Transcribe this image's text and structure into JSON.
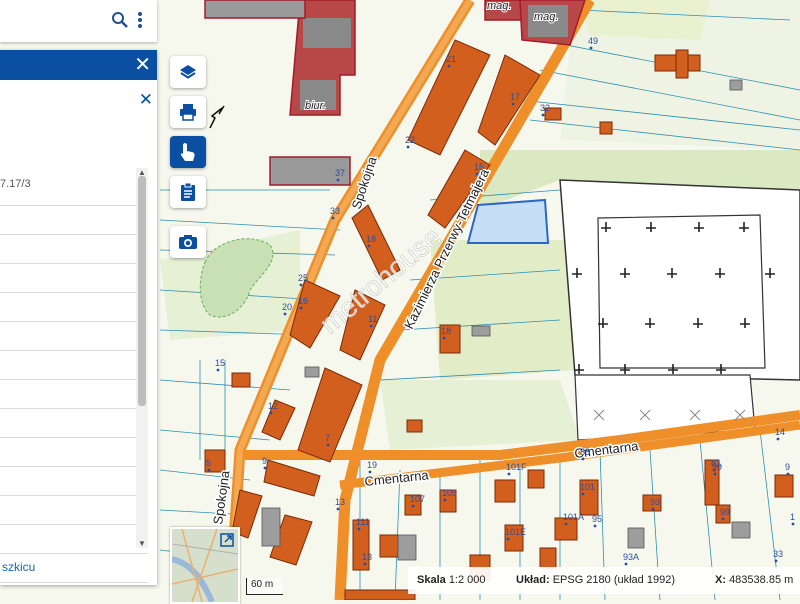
{
  "map": {
    "streets": [
      "Spokojna",
      "Spokojna",
      "Kazimierza Przerwy-Tetmajera",
      "Cmentarna",
      "Cmentarna"
    ],
    "building_labels": [
      "mag.",
      "mag.",
      "biur."
    ],
    "numbers": [
      "49",
      "32",
      "37",
      "33",
      "22",
      "21",
      "17",
      "15",
      "18",
      "25",
      "16",
      "20",
      "11",
      "18",
      "15",
      "12",
      "7",
      "9",
      "5",
      "19",
      "13",
      "88",
      "95",
      "107",
      "105",
      "101",
      "101A",
      "101F",
      "93",
      "99",
      "93A",
      "101E",
      "111",
      "81",
      "99",
      "33",
      "9",
      "1",
      "14",
      "13"
    ],
    "watermark": "metrohouse"
  },
  "search": {
    "search_icon": "search-icon",
    "menu_icon": "kebab-menu-icon"
  },
  "side_panel": {
    "close_icon": "close-icon",
    "parcel_fragment": "7.17/3",
    "rows": [
      "",
      "",
      "",
      "",
      "",
      "",
      "",
      "",
      "",
      "",
      "",
      "",
      ""
    ],
    "sketch_link": "szkicu"
  },
  "tools": [
    "layers-icon",
    "print-icon",
    "hand-pointer-icon",
    "clipboard-icon",
    "camera-icon"
  ],
  "scale": {
    "label": "60 m"
  },
  "status": {
    "scale_label": "Skala",
    "scale_value": "1:2 000",
    "crs_label": "Układ:",
    "crs_value": "EPSG 2180 (układ 1992)",
    "x_label": "X:",
    "x_value": "483538.85 m"
  },
  "colors": {
    "accent": "#0b4fa2",
    "building": "#d35f1e",
    "road": "#ee8f2a",
    "parcel_lines": "#2d8fb0"
  }
}
